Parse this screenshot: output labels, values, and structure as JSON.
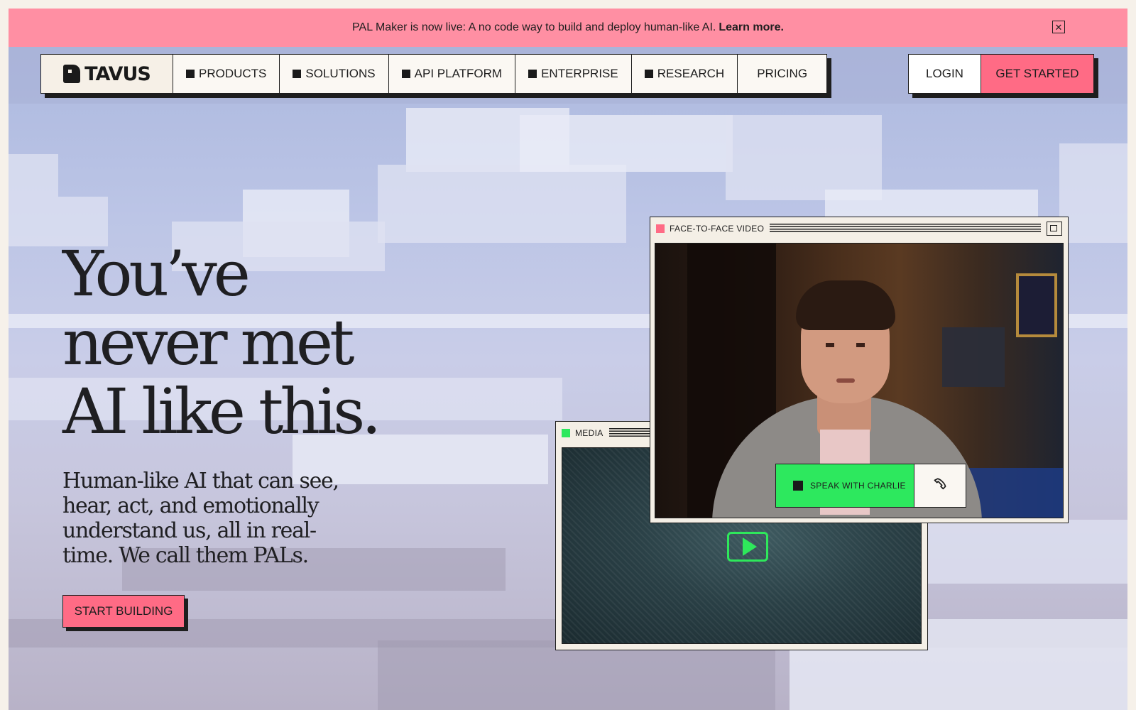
{
  "banner": {
    "text": "PAL Maker is now live: A no code way to build and deploy human-like AI.",
    "link": "Learn more.",
    "close_icon": "close-icon"
  },
  "nav": {
    "logo_text": "TAVUS",
    "items": [
      {
        "label": "PRODUCTS",
        "has_marker": true
      },
      {
        "label": "SOLUTIONS",
        "has_marker": true
      },
      {
        "label": "API PLATFORM",
        "has_marker": true
      },
      {
        "label": "ENTERPRISE",
        "has_marker": true
      },
      {
        "label": "RESEARCH",
        "has_marker": true
      },
      {
        "label": "PRICING",
        "has_marker": false
      }
    ],
    "login": "LOGIN",
    "get_started": "GET STARTED"
  },
  "hero": {
    "headline_lines": [
      "You’ve",
      "never met",
      "AI like this."
    ],
    "subheadline": "Human-like AI that can see, hear, act, and emotionally understand us, all in real-time. We call them PALs.",
    "cta": "START BUILDING"
  },
  "media_window": {
    "title": "MEDIA",
    "title_dot_color": "#2de85e",
    "play_icon": "play-icon"
  },
  "video_window": {
    "title": "FACE-TO-FACE VIDEO",
    "title_dot_color": "#ff6b85",
    "expand_icon": "expand-icon",
    "speak_label": "SPEAK WITH CHARLIE",
    "phone_icon": "phone-icon"
  },
  "colors": {
    "banner_bg": "#ff8fa3",
    "accent_pink": "#ff6b85",
    "accent_green": "#2de85e",
    "ink": "#1e1e1e"
  }
}
